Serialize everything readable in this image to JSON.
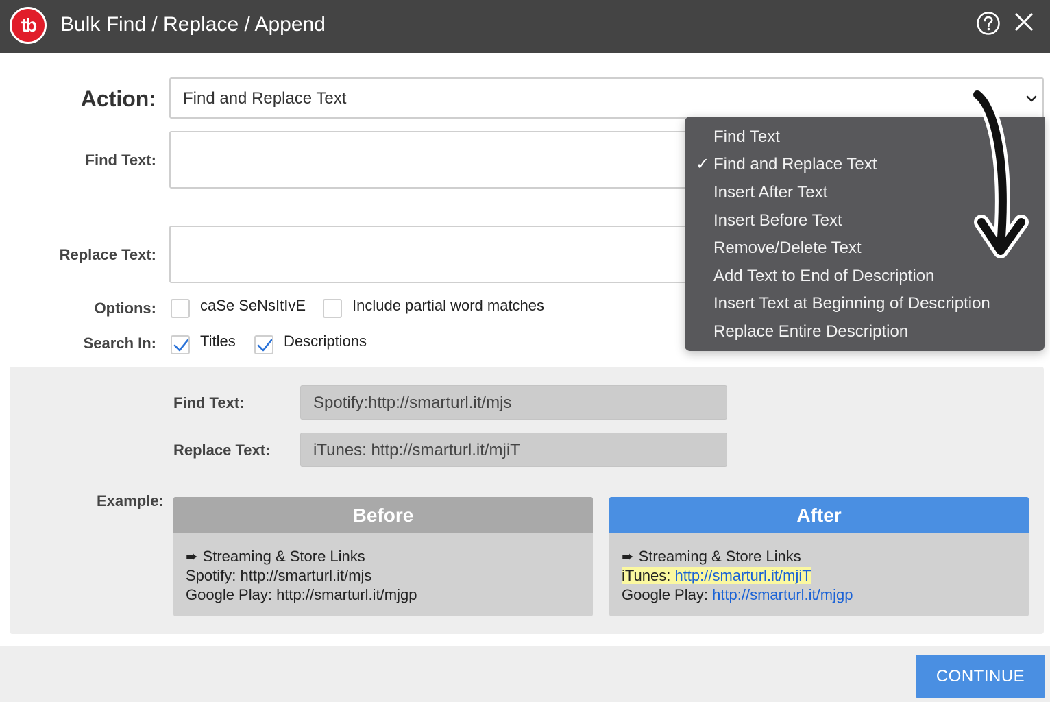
{
  "header": {
    "logo_text": "tb",
    "title": "Bulk Find / Replace / Append",
    "help_icon": "question-circle-icon",
    "close_icon": "close-icon"
  },
  "form": {
    "action_label": "Action:",
    "action_value": "Find and Replace Text",
    "find_label": "Find Text:",
    "find_value": "",
    "replace_label": "Replace Text:",
    "replace_value": "",
    "options_label": "Options:",
    "options": [
      {
        "label": "caSe SeNsItIvE",
        "checked": false
      },
      {
        "label": "Include partial word matches",
        "checked": false
      }
    ],
    "search_in_label": "Search In:",
    "search_in": [
      {
        "label": "Titles",
        "checked": true
      },
      {
        "label": "Descriptions",
        "checked": true
      }
    ]
  },
  "dropdown": {
    "items": [
      "Find Text",
      "Find and Replace Text",
      "Insert After Text",
      "Insert Before Text",
      "Remove/Delete Text",
      "Add Text to End of Description",
      "Insert Text at Beginning of Description",
      "Replace Entire Description"
    ],
    "selected": "Find and Replace Text",
    "check_mark": "✓"
  },
  "example": {
    "find_label": "Find Text:",
    "find_value": "Spotify:http://smarturl.it/mjs",
    "replace_label": "Replace Text:",
    "replace_value": "iTunes: http://smarturl.it/mjiT",
    "example_label": "Example:",
    "before": {
      "title": "Before",
      "arrow": "➨",
      "line1": "Streaming & Store Links",
      "line2": "Spotify: http://smarturl.it/mjs",
      "line3": "Google Play: http://smarturl.it/mjgp"
    },
    "after": {
      "title": "After",
      "arrow": "➨",
      "line1": "Streaming & Store Links",
      "line2_prefix": "iTunes: ",
      "line2_link": "http://smarturl.it/mjiT",
      "line3_prefix": "Google Play: ",
      "line3_link": "http://smarturl.it/mjgp"
    }
  },
  "footer": {
    "continue_label": "CONTINUE"
  },
  "colors": {
    "titlebar": "#444444",
    "logo_red": "#e11d2a",
    "accent_blue": "#4a8fe2",
    "link_blue": "#1a62d6",
    "highlight_yellow": "#fbf8a0",
    "dropdown_bg": "#58585b"
  }
}
